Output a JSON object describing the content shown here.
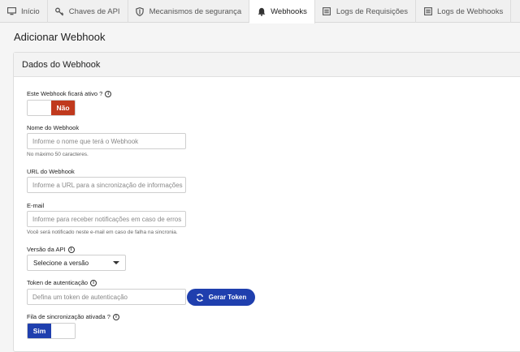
{
  "tabs": [
    {
      "label": "Início",
      "icon": "monitor-icon"
    },
    {
      "label": "Chaves de API",
      "icon": "key-icon"
    },
    {
      "label": "Mecanismos de segurança",
      "icon": "shield-icon"
    },
    {
      "label": "Webhooks",
      "icon": "bell-icon",
      "active": true
    },
    {
      "label": "Logs de Requisições",
      "icon": "log-icon"
    },
    {
      "label": "Logs de Webhooks",
      "icon": "log-icon"
    }
  ],
  "page": {
    "title": "Adicionar Webhook"
  },
  "card": {
    "header": "Dados do Webhook"
  },
  "form": {
    "active": {
      "label": "Este Webhook ficará ativo ?",
      "value_label": "Não",
      "value": false
    },
    "name": {
      "label": "Nome do Webhook",
      "placeholder": "Informe o nome que terá o Webhook",
      "help": "No máximo 50 caracteres."
    },
    "url": {
      "label": "URL do Webhook",
      "placeholder": "Informe a URL para a sincronização de informações"
    },
    "email": {
      "label": "E-mail",
      "placeholder": "Informe para receber notificações em caso de erros",
      "help": "Você será notificado neste e-mail em caso de falha na sincronia."
    },
    "api_version": {
      "label": "Versão da API",
      "selected": "Selecione a versão"
    },
    "token": {
      "label": "Token de autenticação",
      "placeholder": "Defina um token de autenticação",
      "button": "Gerar Token"
    },
    "queue": {
      "label": "Fila de sincronização ativada ?",
      "value_label": "Sim",
      "value": true
    }
  },
  "colors": {
    "no": "#c0391d",
    "yes": "#1f3fae"
  }
}
